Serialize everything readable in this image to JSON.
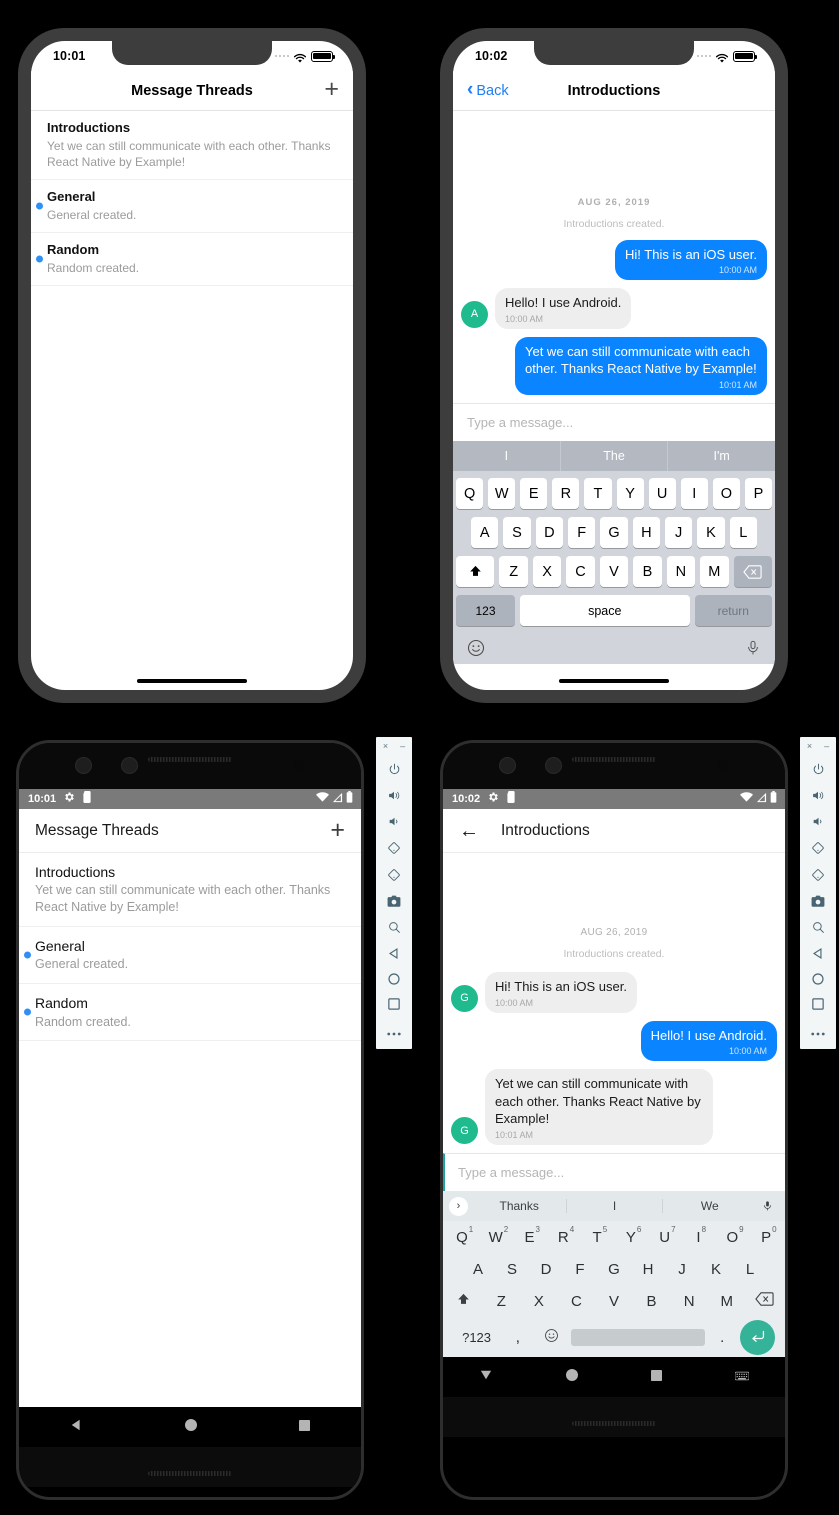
{
  "ios_threads": {
    "status": {
      "time": "10:01",
      "wifi_icon": "wifi-icon",
      "battery_icon": "battery-icon"
    },
    "navbar": {
      "title": "Message Threads",
      "add_label": "+"
    },
    "threads": [
      {
        "name": "Introductions",
        "preview": "Yet we can still communicate with each other. Thanks React Native by Example!",
        "unread": false
      },
      {
        "name": "General",
        "preview": "General created.",
        "unread": true
      },
      {
        "name": "Random",
        "preview": "Random created.",
        "unread": true
      }
    ]
  },
  "ios_chat": {
    "status": {
      "time": "10:02"
    },
    "navbar": {
      "back_label": "Back",
      "title": "Introductions"
    },
    "date_divider": "AUG 26, 2019",
    "system_message": "Introductions created.",
    "messages": [
      {
        "text": "Hi! This is an iOS user.",
        "time": "10:00 AM",
        "side": "out",
        "avatar": ""
      },
      {
        "text": "Hello! I use Android.",
        "time": "10:00 AM",
        "side": "in",
        "avatar": "A"
      },
      {
        "text": "Yet we can still communicate with each other. Thanks React Native by Example!",
        "time": "10:01 AM",
        "side": "out",
        "avatar": ""
      }
    ],
    "input_placeholder": "Type a message...",
    "keyboard": {
      "suggestions": [
        "I",
        "The",
        "I'm"
      ],
      "row1": [
        "Q",
        "W",
        "E",
        "R",
        "T",
        "Y",
        "U",
        "I",
        "O",
        "P"
      ],
      "row2": [
        "A",
        "S",
        "D",
        "F",
        "G",
        "H",
        "J",
        "K",
        "L"
      ],
      "row3": [
        "Z",
        "X",
        "C",
        "V",
        "B",
        "N",
        "M"
      ],
      "shift_icon": "shift-icon",
      "backspace_icon": "backspace-icon",
      "num_label": "123",
      "space_label": "space",
      "return_label": "return",
      "emoji_icon": "emoji-icon",
      "mic_icon": "microphone-icon"
    }
  },
  "android_threads": {
    "status": {
      "time": "10:01",
      "gear_icon": "gear-icon",
      "sdcard_icon": "sdcard-icon",
      "wifi_icon": "wifi-icon",
      "signal_icon": "signal-icon",
      "battery_icon": "battery-icon"
    },
    "appbar": {
      "title": "Message Threads",
      "add_label": "+"
    },
    "threads": [
      {
        "name": "Introductions",
        "preview": "Yet we can still communicate with each other. Thanks React Native by Example!",
        "unread": false
      },
      {
        "name": "General",
        "preview": "General created.",
        "unread": true
      },
      {
        "name": "Random",
        "preview": "Random created.",
        "unread": true
      }
    ],
    "navbar": {
      "back_icon": "back-triangle-icon",
      "home_icon": "home-circle-icon",
      "recents_icon": "recents-square-icon"
    }
  },
  "android_chat": {
    "status": {
      "time": "10:02"
    },
    "appbar": {
      "back_icon": "back-arrow-icon",
      "title": "Introductions"
    },
    "date_divider": "AUG 26, 2019",
    "system_message": "Introductions created.",
    "messages": [
      {
        "text": "Hi! This is an iOS user.",
        "time": "10:00 AM",
        "side": "in",
        "avatar": "G"
      },
      {
        "text": "Hello! I use Android.",
        "time": "10:00 AM",
        "side": "out",
        "avatar": ""
      },
      {
        "text": "Yet we can still communicate with each other. Thanks React Native by Example!",
        "time": "10:01 AM",
        "side": "in",
        "avatar": "G"
      }
    ],
    "input_placeholder": "Type a message...",
    "keyboard": {
      "suggestions": [
        "Thanks",
        "I",
        "We"
      ],
      "expand_icon": "chevron-right-icon",
      "mic_icon": "microphone-icon",
      "row1": [
        {
          "k": "Q",
          "n": "1"
        },
        {
          "k": "W",
          "n": "2"
        },
        {
          "k": "E",
          "n": "3"
        },
        {
          "k": "R",
          "n": "4"
        },
        {
          "k": "T",
          "n": "5"
        },
        {
          "k": "Y",
          "n": "6"
        },
        {
          "k": "U",
          "n": "7"
        },
        {
          "k": "I",
          "n": "8"
        },
        {
          "k": "O",
          "n": "9"
        },
        {
          "k": "P",
          "n": "0"
        }
      ],
      "row2": [
        "A",
        "S",
        "D",
        "F",
        "G",
        "H",
        "J",
        "K",
        "L"
      ],
      "row3": [
        "Z",
        "X",
        "C",
        "V",
        "B",
        "N",
        "M"
      ],
      "shift_icon": "shift-icon",
      "backspace_icon": "backspace-icon",
      "sym_label": "?123",
      "comma_label": ",",
      "emoji_icon": "emoji-icon",
      "period_label": ".",
      "enter_icon": "enter-icon"
    },
    "navbar": {
      "back_icon": "back-triangle-icon",
      "home_icon": "home-circle-icon",
      "recents_icon": "recents-square-icon",
      "keyboard_icon": "keyboard-icon"
    }
  },
  "emulator_toolbar": {
    "close_label": "×",
    "minimize_label": "–",
    "buttons": [
      "power-icon",
      "volume-up-icon",
      "volume-down-icon",
      "rotate-left-icon",
      "rotate-right-icon",
      "camera-icon",
      "zoom-icon",
      "back-icon",
      "home-icon",
      "overview-icon",
      "more-icon"
    ]
  },
  "colors": {
    "ios_blue": "#0a84ff",
    "avatar_green": "#1fba8e",
    "unread_dot": "#2f8ff5",
    "android_enter": "#34b399"
  }
}
